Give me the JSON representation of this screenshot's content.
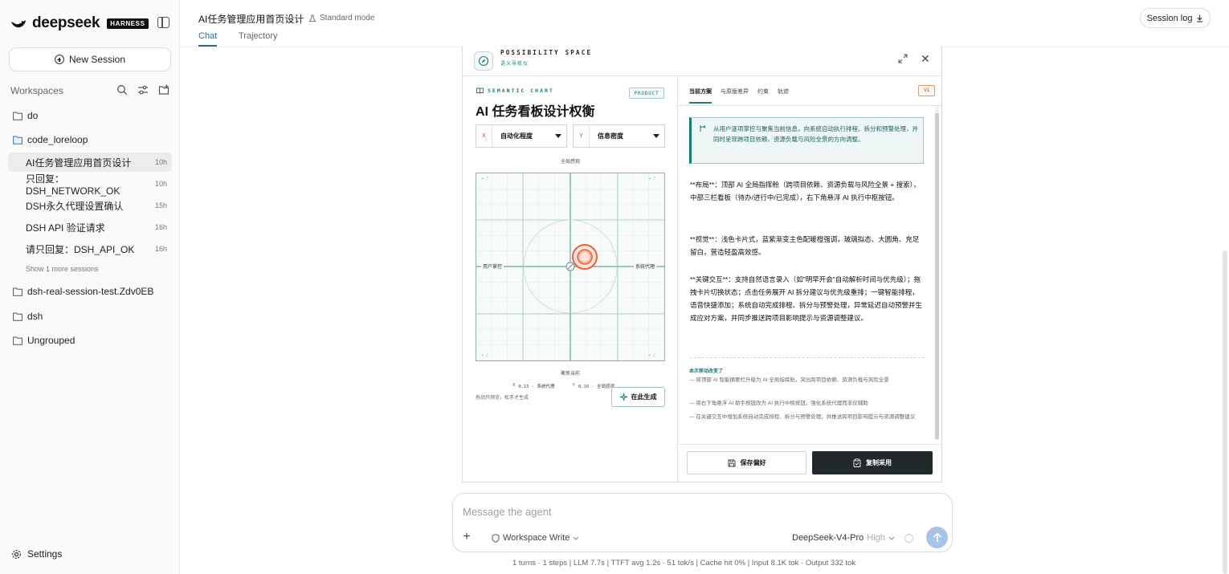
{
  "app": {
    "brand": "deepseek",
    "badge": "HARNESS"
  },
  "sidebar": {
    "new_session": "New Session",
    "workspaces_label": "Workspaces",
    "folders": [
      "do",
      "code_loreloop",
      "dsh-real-session-test.Zdv0EB",
      "dsh",
      "Ungrouped"
    ],
    "sessions": [
      {
        "title": "AI任务管理应用首页设计",
        "age": "10h"
      },
      {
        "title": "只回复：DSH_NETWORK_OK",
        "age": "10h"
      },
      {
        "title": "DSH永久代理设置确认",
        "age": "15h"
      },
      {
        "title": "DSH API 验证请求",
        "age": "16h"
      },
      {
        "title": "请只回复：DSH_API_OK",
        "age": "16h"
      }
    ],
    "show_more": "Show 1 more sessions",
    "settings": "Settings"
  },
  "header": {
    "title": "AI任务管理应用首页设计",
    "mode": "Standard mode",
    "tabs": [
      "Chat",
      "Trajectory"
    ],
    "session_log": "Session log"
  },
  "preview": {
    "brand": "POSSIBILITY SPACE",
    "brand_sub": "语义导航仪",
    "left": {
      "eyebrow": "SEMANTIC CHART",
      "badge": "PRODUCT",
      "title": "AI 任务看板设计权衡",
      "x_letter": "X",
      "x_value": "自动化程度",
      "y_letter": "Y",
      "y_value": "信息密度",
      "scope_top": "全局感观",
      "focus_bottom": "聚焦当前",
      "left_label": "用户掌控",
      "right_label": "系统代理",
      "coord_x_key": "X",
      "coord_x": "0.15 · 系统代理",
      "coord_y_key": "Y",
      "coord_y": "0.10 · 全局感观",
      "drag_hint": "拖动只预览，松手才生成",
      "generate": "在此生成"
    },
    "right": {
      "tabs": [
        "当前方案",
        "与原版差异",
        "约束",
        "轨迹"
      ],
      "version": "V1",
      "callout": "从用户逐项掌控与聚焦当前信息，向系统自动执行排程、拆分和预警处理，并同时呈现跨项目依赖、资源负载与风险全景的方向调整。",
      "p_layout": "**布局**：顶部 AI 全局指挥舱（跨项目依赖、资源负载与风险全景 + 搜索），中部三栏看板（待办/进行中/已完成），右下角悬浮 AI 执行中枢按钮。",
      "p_visual": "**视觉**：浅色卡片式，蓝紫渐变主色配暖橙强调，玻璃拟态、大圆角、充足留白，营造轻盈高效感。",
      "p_interact": "**关键交互**：支持自然语言录入（如\"明早开会\"自动解析时间与优先级）；拖拽卡片切换状态；点击任务展开 AI 拆分建议与优先级重排；一键智能排程，语音快捷添加；系统自动完成排程、拆分与预警处理，异常延迟自动预警并生成应对方案，并同步推送跨项目影响提示与资源调整建议。",
      "changes_title": "本次移动改变了",
      "changes": [
        "— 将顶部 AI 智能摘要栏升级为 AI 全局指挥舱，突出跨项目依赖、资源负载与风险全景",
        "— 将右下角悬浮 AI 助手按钮改为 AI 执行中枢按钮，强化系统代理而非仅辅助",
        "— 在关键交互中增加系统自动完成排程、拆分与预警处理，并推送跨项目影响提示与资源调整建议"
      ],
      "save": "保存偏好",
      "copy": "复制采用"
    }
  },
  "composer": {
    "placeholder": "Message the agent",
    "mode": "Workspace Write",
    "model": "DeepSeek-V4-Pro",
    "effort": "High"
  },
  "stats": "1 turns · 1 steps   |   LLM 7.7s   |   TTFT avg 1.2s · 51 tok/s   |   Cache hit 0%   |   Input 8.1K tok · Output 332 tok",
  "colors": {
    "accent": "#1a7a7a",
    "tab_active": "#2a6f8a",
    "send": "#a8c3e6",
    "marker": "#e8623a"
  }
}
